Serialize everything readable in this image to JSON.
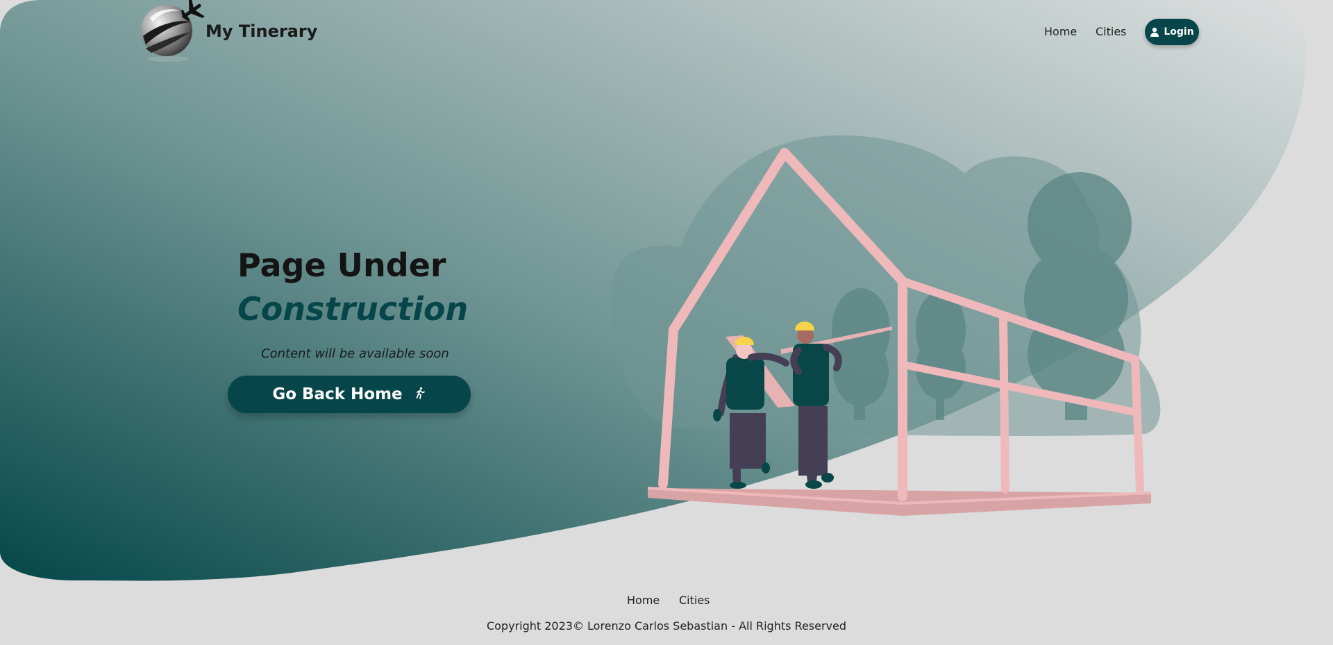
{
  "brand": {
    "name": "My Tinerary",
    "logo_icon": "globe-airplane-icon"
  },
  "nav": {
    "home": "Home",
    "cities": "Cities",
    "login": "Login",
    "login_icon": "user-icon"
  },
  "hero": {
    "title_line1": "Page Under",
    "title_line2": "Construction",
    "subtitle": "Content will be available soon",
    "cta": "Go Back Home",
    "cta_icon": "walking-person-icon",
    "illustration": "house-frame-construction-workers"
  },
  "footer": {
    "links": [
      "Home",
      "Cities"
    ],
    "copyright": "Copyright 2023© Lorenzo Carlos Sebastian - All Rights Reserved"
  },
  "colors": {
    "accent": "#06454a",
    "page_bg": "#dcdcdc",
    "frame_pink": "#efb9bb",
    "helmet_yellow": "#f6d34a"
  }
}
